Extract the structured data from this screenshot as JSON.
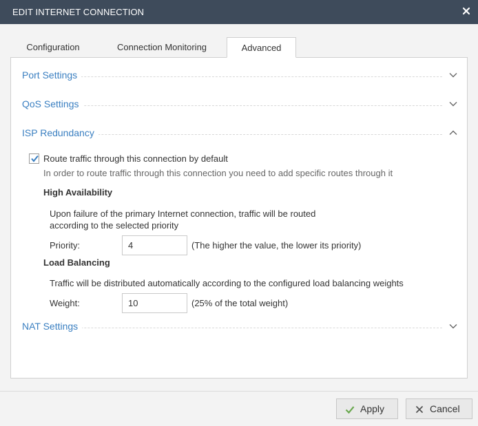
{
  "window": {
    "title": "EDIT INTERNET CONNECTION",
    "close_icon": "close-icon"
  },
  "tabs": [
    {
      "label": "Configuration",
      "active": false
    },
    {
      "label": "Connection Monitoring",
      "active": false
    },
    {
      "label": "Advanced",
      "active": true
    }
  ],
  "sections": {
    "port_settings": {
      "label": "Port Settings",
      "expanded": false
    },
    "qos_settings": {
      "label": "QoS Settings",
      "expanded": false
    },
    "isp_redundancy": {
      "label": "ISP Redundancy",
      "expanded": true
    },
    "nat_settings": {
      "label": "NAT Settings",
      "expanded": false
    }
  },
  "isp": {
    "route_default_checked": true,
    "route_default_label": "Route traffic through this connection by default",
    "route_hint": "In order to route traffic through this connection you need to add specific routes through it",
    "high_availability": {
      "heading": "High Availability",
      "description_line1": "Upon failure of the primary Internet connection, traffic will be routed",
      "description_line2": "according to the selected priority",
      "priority_label": "Priority:",
      "priority_value": "4",
      "priority_note": "(The higher the value, the lower its priority)"
    },
    "load_balancing": {
      "heading": "Load Balancing",
      "description": "Traffic will be distributed automatically according to the configured load balancing weights",
      "weight_label": "Weight:",
      "weight_value": "10",
      "weight_note": "(25% of the total weight)"
    }
  },
  "footer": {
    "apply_label": "Apply",
    "cancel_label": "Cancel"
  },
  "colors": {
    "titlebar": "#3e4b5b",
    "section_link": "#3a7fc1",
    "apply_check": "#6aa84f"
  }
}
